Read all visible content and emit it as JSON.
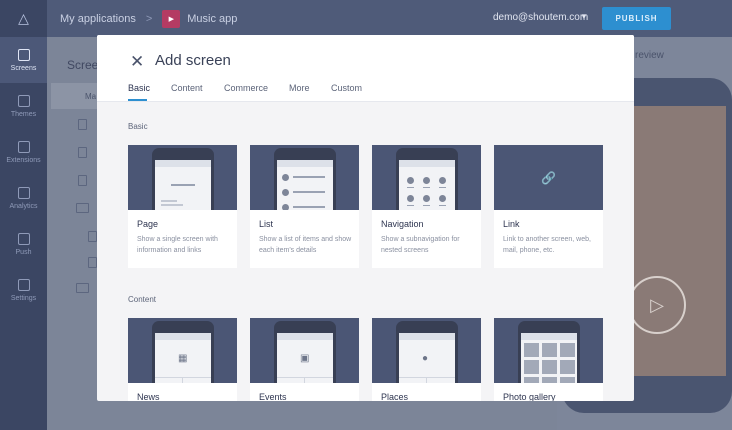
{
  "rail": {
    "items": [
      {
        "label": "Screens",
        "icon": "phone-icon"
      },
      {
        "label": "Themes",
        "icon": "palette-icon"
      },
      {
        "label": "Extensions",
        "icon": "puzzle-icon"
      },
      {
        "label": "Analytics",
        "icon": "chart-icon"
      },
      {
        "label": "Push",
        "icon": "push-icon"
      },
      {
        "label": "Settings",
        "icon": "gear-icon"
      }
    ]
  },
  "topbar": {
    "breadcrumb_root": "My applications",
    "separator": ">",
    "app_name": "Music app",
    "user_email": "demo@shoutem.com",
    "publish_label": "PUBLISH"
  },
  "panel": {
    "title": "Screen",
    "first_row": "Ma"
  },
  "preview": {
    "label": "review"
  },
  "modal": {
    "title": "Add screen",
    "tabs": [
      "Basic",
      "Content",
      "Commerce",
      "More",
      "Custom"
    ],
    "sections": [
      {
        "title": "Basic",
        "cards": [
          {
            "title": "Page",
            "description": "Show a single screen with information and links",
            "mock": "page"
          },
          {
            "title": "List",
            "description": "Show a list of items and show each item's details",
            "mock": "list"
          },
          {
            "title": "Navigation",
            "description": "Show a subnavigation for nested screens",
            "mock": "grid"
          },
          {
            "title": "Link",
            "description": "Link to another screen, web, mail, phone, etc.",
            "mock": "link"
          }
        ]
      },
      {
        "title": "Content",
        "cards": [
          {
            "title": "News",
            "mock": "news"
          },
          {
            "title": "Events",
            "mock": "events"
          },
          {
            "title": "Places",
            "mock": "places"
          },
          {
            "title": "Photo gallery",
            "mock": "gallery"
          }
        ]
      }
    ]
  },
  "colors": {
    "accent": "#2d8fd0",
    "card_header": "#4b5675",
    "app_thumb": "#b43b63"
  }
}
